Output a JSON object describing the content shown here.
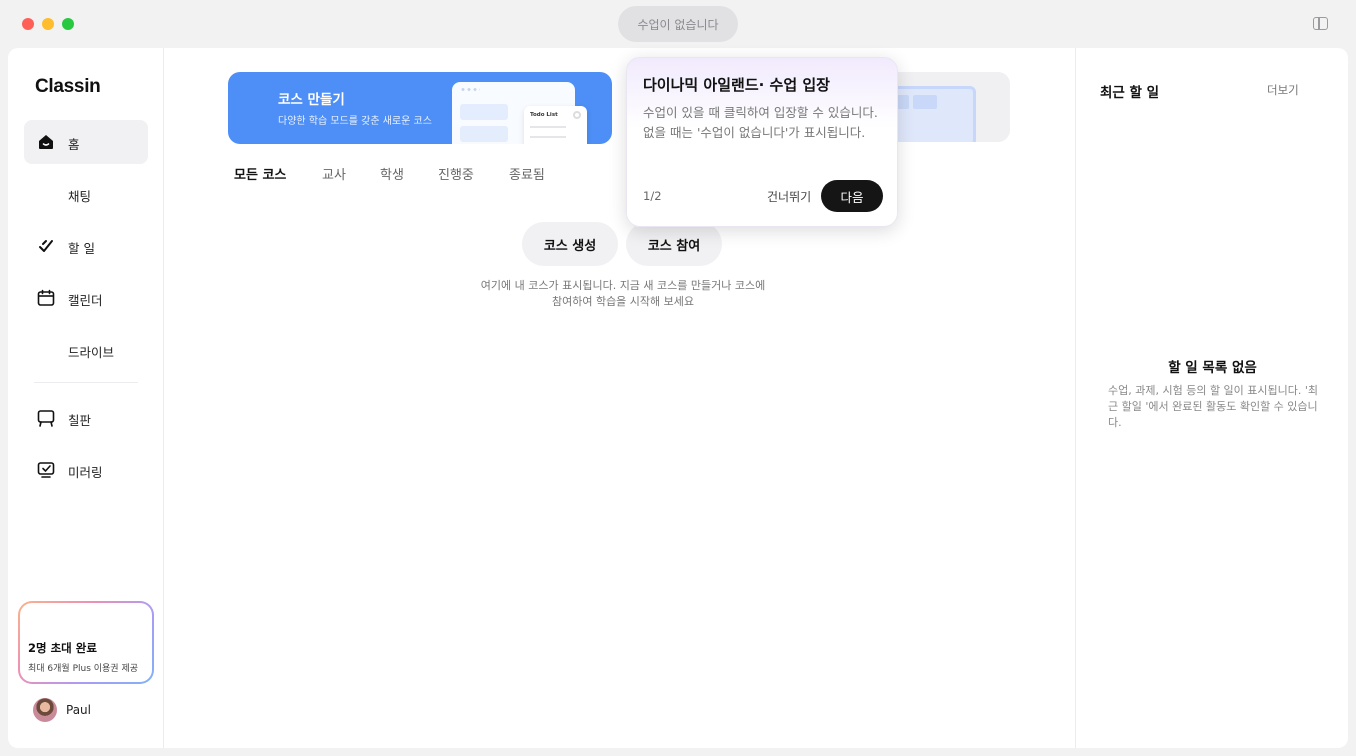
{
  "titlebar": {
    "class_status": "수업이 없습니다"
  },
  "sidebar": {
    "logo": "Classin",
    "items": [
      {
        "label": "홈",
        "icon": "home-icon",
        "active": true
      },
      {
        "label": "채팅",
        "icon": "chat-icon"
      },
      {
        "label": "할 일",
        "icon": "todo-icon"
      },
      {
        "label": "캘린더",
        "icon": "calendar-icon"
      },
      {
        "label": "드라이브",
        "icon": "drive-icon"
      },
      {
        "label": "칠판",
        "icon": "blackboard-icon"
      },
      {
        "label": "미러링",
        "icon": "mirroring-icon"
      }
    ],
    "invite": {
      "title": "2명 초대 완료",
      "subtitle": "최대 6개월 Plus 이용권 제공"
    },
    "user": {
      "name": "Paul"
    }
  },
  "main": {
    "banner": {
      "title": "코스 만들기",
      "subtitle": "다양한 학습 모드를 갖춘 새로운 코스",
      "todo_label": "Todo List"
    },
    "tabs": [
      "모든 코스",
      "교사",
      "학생",
      "진행중",
      "종료됨"
    ],
    "create_button": "코스 생성",
    "join_button": "코스 참여",
    "empty_hint_line1": "여기에 내 코스가 표시됩니다. 지금 새 코스를 만들거나 코스에",
    "empty_hint_line2": "참여하여 학습을 시작해 보세요"
  },
  "right_panel": {
    "title": "최근 할 일",
    "more": "더보기",
    "empty_title": "할 일 목록 없음",
    "empty_text": "수업, 과제, 시험 등의 할 일이 표시됩니다. '최근 할일 '에서 완료된 활동도 확인할 수 있습니다."
  },
  "popover": {
    "title": "다이나믹 아일랜드· 수업 입장",
    "body": "수업이 있을 때 클릭하여 입장할 수 있습니다. 없을 때는 '수업이 없습니다'가 표시됩니다.",
    "step": "1/2",
    "skip": "건너뛰기",
    "next": "다음"
  },
  "colors": {
    "accent": "#4d8ff6",
    "primary_button": "#151515"
  }
}
